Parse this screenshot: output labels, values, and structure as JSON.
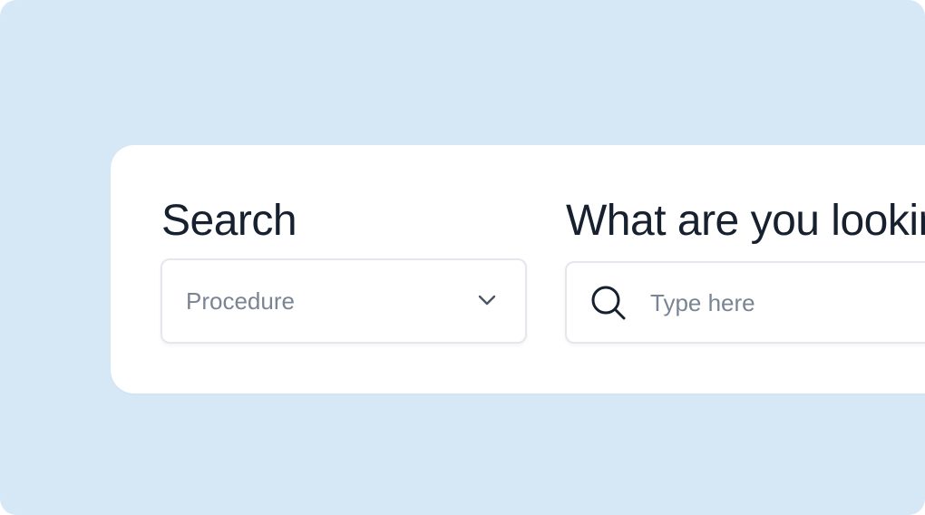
{
  "search_section": {
    "label": "Search",
    "select": {
      "selected": "Procedure",
      "icon": "chevron-down-icon"
    }
  },
  "query_section": {
    "label": "What are you looking for?",
    "input": {
      "value": "",
      "placeholder": "Type here",
      "icon": "search-icon"
    }
  },
  "colors": {
    "background": "#d6e8f6",
    "card": "#ffffff",
    "label_text": "#16202e",
    "muted_text": "#7a8594",
    "border": "#e4e7eb"
  }
}
